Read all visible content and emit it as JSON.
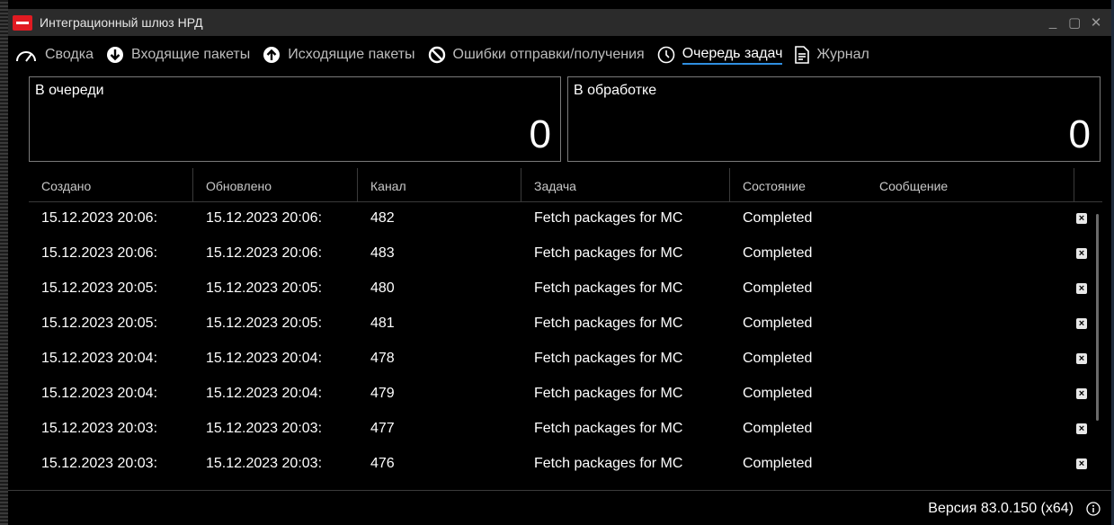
{
  "window": {
    "title": "Интеграционный шлюз НРД",
    "controls": [
      "_",
      "▢",
      "✕"
    ]
  },
  "nav": {
    "items": [
      {
        "label": "Сводка",
        "icon": "gauge-icon",
        "active": false
      },
      {
        "label": "Входящие пакеты",
        "icon": "arrow-down-circle-icon",
        "active": false
      },
      {
        "label": "Исходящие пакеты",
        "icon": "arrow-up-circle-icon",
        "active": false
      },
      {
        "label": "Ошибки отправки/получения",
        "icon": "prohibited-icon",
        "active": false
      },
      {
        "label": "Очередь задач",
        "icon": "clock-icon",
        "active": true
      },
      {
        "label": "Журнал",
        "icon": "document-icon",
        "active": false
      }
    ]
  },
  "counters": {
    "queued": {
      "label": "В очереди",
      "value": "0"
    },
    "processing": {
      "label": "В обработке",
      "value": "0"
    }
  },
  "table": {
    "columns": [
      "Создано",
      "Обновлено",
      "Канал",
      "Задача",
      "Состояние",
      "Сообщение"
    ],
    "rows": [
      {
        "created": "15.12.2023 20:06:",
        "updated": "15.12.2023 20:06:",
        "channel": "482",
        "task": "Fetch packages for MC",
        "state": "Completed",
        "message": ""
      },
      {
        "created": "15.12.2023 20:06:",
        "updated": "15.12.2023 20:06:",
        "channel": "483",
        "task": "Fetch packages for MC",
        "state": "Completed",
        "message": ""
      },
      {
        "created": "15.12.2023 20:05:",
        "updated": "15.12.2023 20:05:",
        "channel": "480",
        "task": "Fetch packages for MC",
        "state": "Completed",
        "message": ""
      },
      {
        "created": "15.12.2023 20:05:",
        "updated": "15.12.2023 20:05:",
        "channel": "481",
        "task": "Fetch packages for MC",
        "state": "Completed",
        "message": ""
      },
      {
        "created": "15.12.2023 20:04:",
        "updated": "15.12.2023 20:04:",
        "channel": "478",
        "task": "Fetch packages for MC",
        "state": "Completed",
        "message": ""
      },
      {
        "created": "15.12.2023 20:04:",
        "updated": "15.12.2023 20:04:",
        "channel": "479",
        "task": "Fetch packages for MC",
        "state": "Completed",
        "message": ""
      },
      {
        "created": "15.12.2023 20:03:",
        "updated": "15.12.2023 20:03:",
        "channel": "477",
        "task": "Fetch packages for MC",
        "state": "Completed",
        "message": ""
      },
      {
        "created": "15.12.2023 20:03:",
        "updated": "15.12.2023 20:03:",
        "channel": "476",
        "task": "Fetch packages for MC",
        "state": "Completed",
        "message": ""
      }
    ]
  },
  "status": {
    "version": "Версия 83.0.150 (x64)",
    "info_icon": "info-icon"
  },
  "colors": {
    "background": "#000000",
    "titlebar": "#2b2b2b",
    "accent": "#2f8fe0",
    "app_icon": "#e11b22"
  }
}
